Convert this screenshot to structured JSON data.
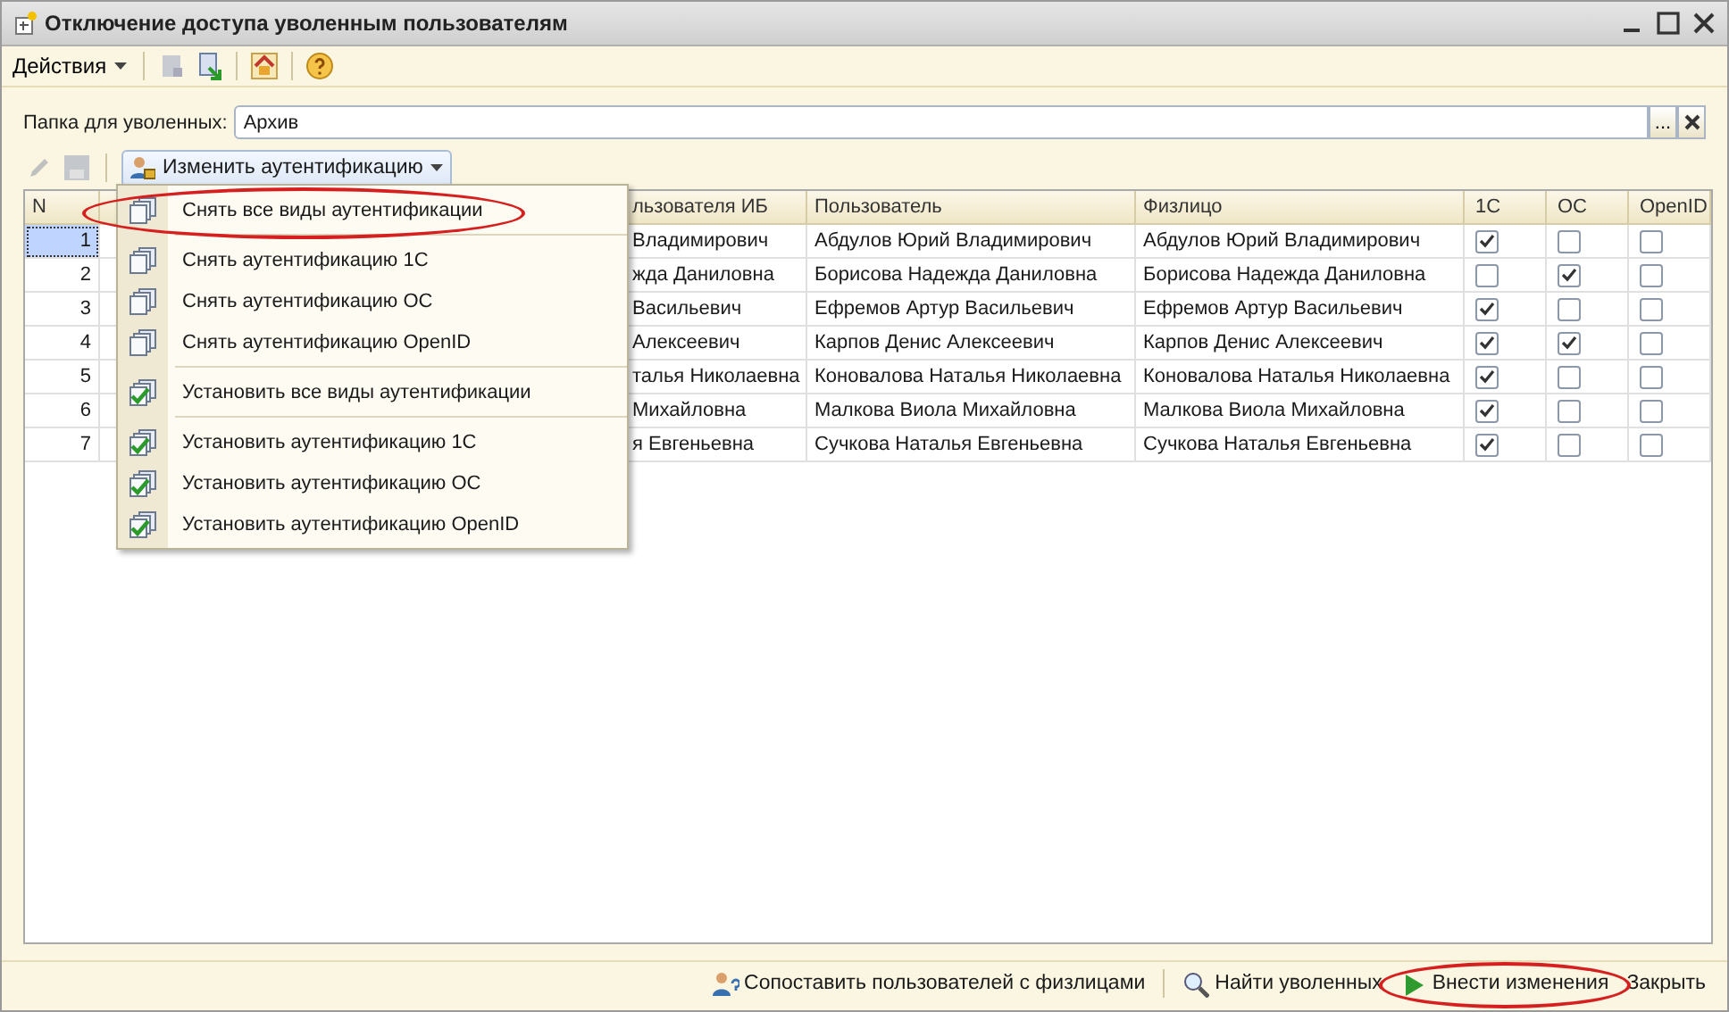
{
  "window": {
    "title": "Отключение доступа уволенным пользователям"
  },
  "toolbar": {
    "actions_label": "Действия"
  },
  "folder": {
    "label": "Папка для уволенных:",
    "value": "Архив",
    "select_button": "..."
  },
  "table_toolbar": {
    "change_auth": "Изменить аутентификацию"
  },
  "table": {
    "columns": [
      "N",
      "льзователя ИБ",
      "Пользователь",
      "Физлицо",
      "1С",
      "ОС",
      "OpenID"
    ],
    "rows": [
      {
        "n": "1",
        "ib_user": "Владимирович",
        "user": "Абдулов Юрий Владимирович",
        "person": "Абдулов Юрий Владимирович",
        "auth_1c": true,
        "auth_os": false,
        "auth_openid": false,
        "selected": true
      },
      {
        "n": "2",
        "ib_user": "жда Даниловна",
        "user": "Борисова Надежда Даниловна",
        "person": "Борисова Надежда Даниловна",
        "auth_1c": false,
        "auth_os": true,
        "auth_openid": false,
        "selected": false
      },
      {
        "n": "3",
        "ib_user": "Васильевич",
        "user": "Ефремов Артур Васильевич",
        "person": "Ефремов Артур Васильевич",
        "auth_1c": true,
        "auth_os": false,
        "auth_openid": false,
        "selected": false
      },
      {
        "n": "4",
        "ib_user": "Алексеевич",
        "user": "Карпов Денис Алексеевич",
        "person": "Карпов Денис Алексеевич",
        "auth_1c": true,
        "auth_os": true,
        "auth_openid": false,
        "selected": false
      },
      {
        "n": "5",
        "ib_user": "талья Николаевна",
        "user": "Коновалова Наталья Николаевна",
        "person": "Коновалова Наталья Николаевна",
        "auth_1c": true,
        "auth_os": false,
        "auth_openid": false,
        "selected": false
      },
      {
        "n": "6",
        "ib_user": "Михайловна",
        "user": "Малкова Виола Михайловна",
        "person": "Малкова Виола Михайловна",
        "auth_1c": true,
        "auth_os": false,
        "auth_openid": false,
        "selected": false
      },
      {
        "n": "7",
        "ib_user": "я Евгеньевна",
        "user": "Сучкова Наталья Евгеньевна",
        "person": "Сучкова Наталья Евгеньевна",
        "auth_1c": true,
        "auth_os": false,
        "auth_openid": false,
        "selected": false
      }
    ]
  },
  "menu": {
    "items": [
      {
        "label": "Снять все виды аутентификации",
        "kind": "remove",
        "highlighted": true
      },
      {
        "label": "Снять аутентификацию 1С",
        "kind": "remove",
        "highlighted": false
      },
      {
        "label": "Снять аутентификацию ОС",
        "kind": "remove",
        "highlighted": false
      },
      {
        "label": "Снять аутентификацию OpenID",
        "kind": "remove",
        "highlighted": false
      },
      {
        "label": "Установить все виды аутентификации",
        "kind": "set",
        "highlighted": false
      },
      {
        "label": "Установить аутентификацию 1С",
        "kind": "set",
        "highlighted": false
      },
      {
        "label": "Установить аутентификацию ОС",
        "kind": "set",
        "highlighted": false
      },
      {
        "label": "Установить аутентификацию OpenID",
        "kind": "set",
        "highlighted": false
      }
    ]
  },
  "footer": {
    "buttons": [
      {
        "label": "Сопоставить пользователей с физлицами",
        "kind": "match",
        "highlighted": false
      },
      {
        "label": "Найти уволенных",
        "kind": "find",
        "highlighted": false
      },
      {
        "label": "Внести изменения",
        "kind": "apply",
        "highlighted": true
      },
      {
        "label": "Закрыть",
        "kind": "close",
        "highlighted": false
      }
    ]
  }
}
